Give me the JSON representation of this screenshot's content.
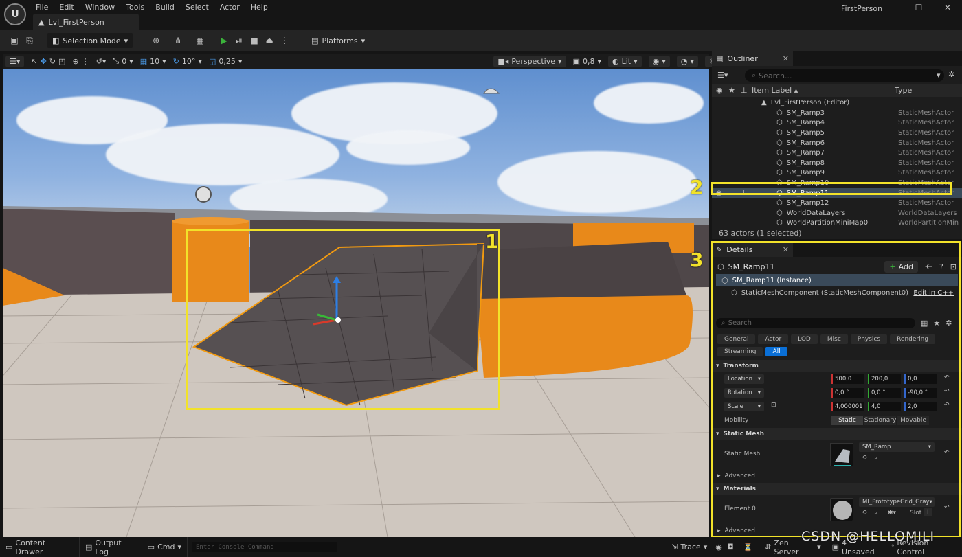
{
  "menu": [
    "File",
    "Edit",
    "Window",
    "Tools",
    "Build",
    "Select",
    "Actor",
    "Help"
  ],
  "doc_tab": "Lvl_FirstPerson",
  "app_title": "FirstPerson",
  "window_buttons": [
    "—",
    "☐",
    "✕"
  ],
  "toolbar": {
    "selection_mode": "Selection Mode",
    "platforms": "Platforms"
  },
  "viewport_toolbar": {
    "rotate_snap": "0",
    "grid_snap": "10",
    "angle_snap": "10°",
    "scale_snap": "0,25",
    "view_mode": "Perspective",
    "camera_speed": "0,8",
    "lit": "Lit"
  },
  "callouts": [
    "1",
    "2",
    "3"
  ],
  "outliner": {
    "tab": "Outliner",
    "search_placeholder": "Search...",
    "col_label": "Item Label ▴",
    "col_type": "Type",
    "root": "Lvl_FirstPerson (Editor)",
    "rows": [
      {
        "label": "SM_Ramp3",
        "type": "StaticMeshActor"
      },
      {
        "label": "SM_Ramp4",
        "type": "StaticMeshActor"
      },
      {
        "label": "SM_Ramp5",
        "type": "StaticMeshActor"
      },
      {
        "label": "SM_Ramp6",
        "type": "StaticMeshActor"
      },
      {
        "label": "SM_Ramp7",
        "type": "StaticMeshActor"
      },
      {
        "label": "SM_Ramp8",
        "type": "StaticMeshActor"
      },
      {
        "label": "SM_Ramp9",
        "type": "StaticMeshActor"
      },
      {
        "label": "SM_Ramp10",
        "type": "StaticMeshActor"
      },
      {
        "label": "SM_Ramp11",
        "type": "StaticMeshActor"
      },
      {
        "label": "SM_Ramp12",
        "type": "StaticMeshActor"
      },
      {
        "label": "WorldDataLayers",
        "type": "WorldDataLayers"
      },
      {
        "label": "WorldPartitionMiniMap0",
        "type": "WorldPartitionMin"
      }
    ],
    "selected_index": 8,
    "footer": "63 actors (1 selected)"
  },
  "details": {
    "tab": "Details",
    "actor_name": "SM_Ramp11",
    "add_label": "Add",
    "instance": "SM_Ramp11 (Instance)",
    "component": "StaticMeshComponent (StaticMeshComponent0)",
    "edit_cpp": "Edit in C++",
    "search_placeholder": "Search",
    "filters": [
      "General",
      "Actor",
      "LOD",
      "Misc",
      "Physics",
      "Rendering",
      "Streaming",
      "All"
    ],
    "active_filter": "All",
    "transform": {
      "section": "Transform",
      "location_label": "Location",
      "location": [
        "500,0",
        "200,0",
        "0,0"
      ],
      "rotation_label": "Rotation",
      "rotation": [
        "0,0 °",
        "0,0 °",
        "-90,0 °"
      ],
      "scale_label": "Scale",
      "scale": [
        "4,000001",
        "4,0",
        "2,0"
      ],
      "mobility_label": "Mobility",
      "mobility": [
        "Static",
        "Stationary",
        "Movable"
      ],
      "mobility_selected": "Static"
    },
    "static_mesh": {
      "section": "Static Mesh",
      "label": "Static Mesh",
      "value": "SM_Ramp",
      "advanced": "Advanced"
    },
    "materials": {
      "section": "Materials",
      "element_label": "Element 0",
      "value": "MI_PrototypeGrid_Gray",
      "slot_label": "Slot",
      "slot_value": "I",
      "advanced": "Advanced"
    }
  },
  "statusbar": {
    "content_drawer": "Content Drawer",
    "output_log": "Output Log",
    "cmd": "Cmd",
    "console_placeholder": "Enter Console Command",
    "trace": "Trace",
    "zen": "Zen Server",
    "unsaved": "4 Unsaved",
    "revision": "Revision Control"
  },
  "watermark": "CSDN @HELLOMILI",
  "colors": {
    "highlight": "#f2e22a",
    "accent_blue": "#0a6fd6",
    "orange": "#e8891a"
  }
}
